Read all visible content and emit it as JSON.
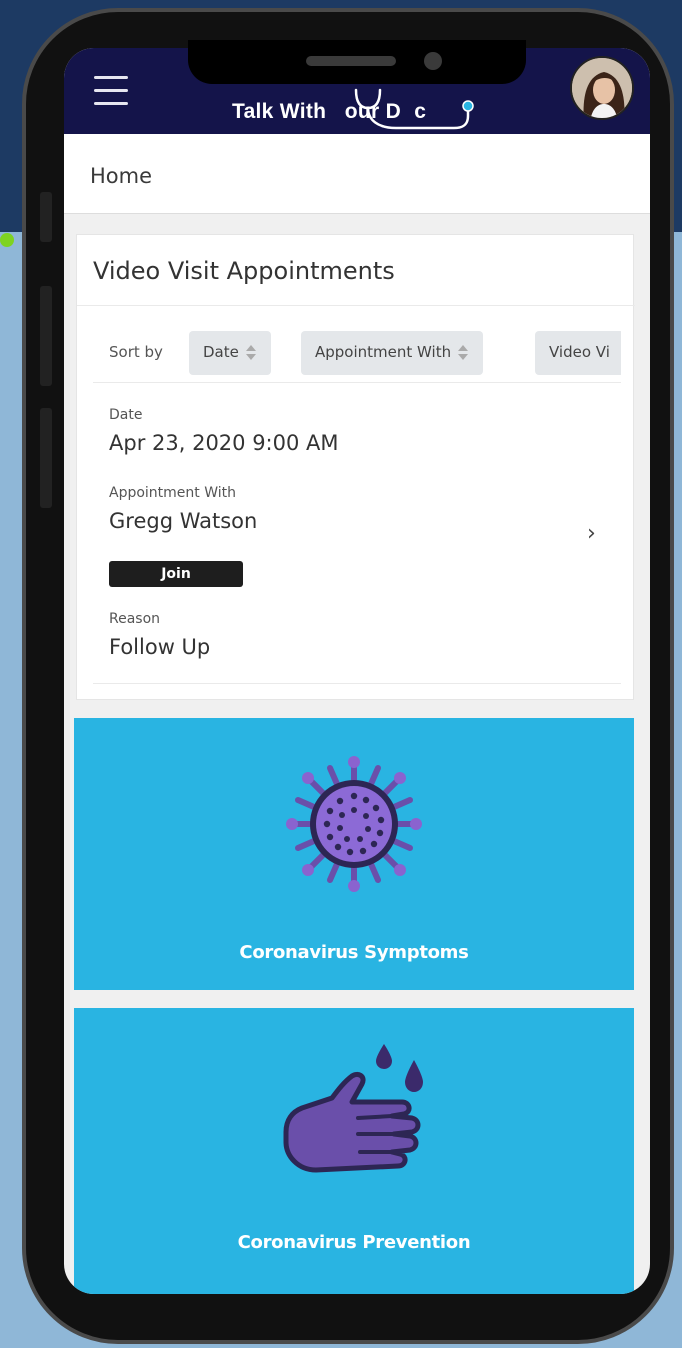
{
  "app": {
    "brand_text": "Talk With Your Doc",
    "brand_prefix": "Talk With ",
    "brand_y": "Y",
    "brand_our": "our D",
    "brand_o": "o",
    "brand_c": "c"
  },
  "header": {
    "menu_icon": "hamburger-icon",
    "avatar_icon": "user-avatar"
  },
  "breadcrumb": {
    "label": "Home"
  },
  "appointments": {
    "title": "Video Visit Appointments",
    "sort": {
      "label": "Sort by",
      "options": [
        "Date",
        "Appointment With",
        "Video Vi"
      ]
    },
    "item": {
      "date_label": "Date",
      "date_value": "Apr 23, 2020 9:00 AM",
      "with_label": "Appointment With",
      "with_value": "Gregg Watson",
      "join_label": "Join",
      "reason_label": "Reason",
      "reason_value": "Follow Up"
    }
  },
  "tiles": [
    {
      "label": "Coronavirus Symptoms",
      "icon": "virus-icon"
    },
    {
      "label": "Coronavirus Prevention",
      "icon": "hand-wash-icon"
    }
  ],
  "colors": {
    "topbar": "#14144a",
    "tile": "#29b4e2",
    "icon_purple": "#6a4faa",
    "join_button": "#1e1e1e"
  }
}
